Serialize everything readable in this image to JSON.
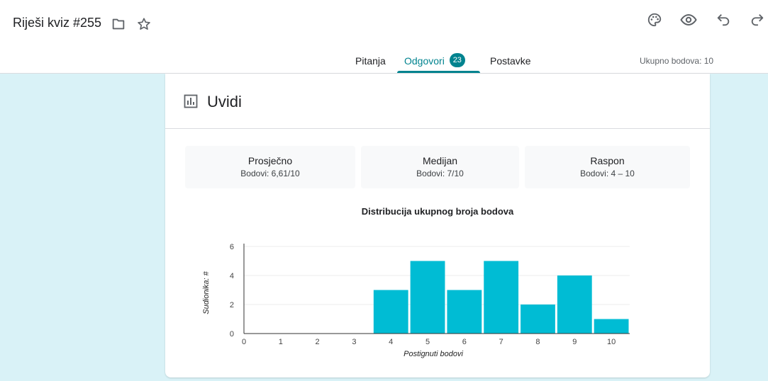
{
  "header": {
    "title": "Riješi kviz #255",
    "tabs": [
      {
        "label": "Pitanja"
      },
      {
        "label": "Odgovori",
        "badge": "23"
      },
      {
        "label": "Postavke"
      }
    ],
    "total_points": "Ukupno bodova: 10"
  },
  "icons": {
    "folder": "folder-icon",
    "star": "star-icon",
    "palette": "palette-icon",
    "preview": "eye-icon",
    "undo": "undo-icon",
    "redo": "redo-icon",
    "insights": "bar-chart-icon"
  },
  "insights": {
    "title": "Uvidi",
    "stats": [
      {
        "label": "Prosječno",
        "value": "Bodovi: 6,61/10"
      },
      {
        "label": "Medijan",
        "value": "Bodovi: 7/10"
      },
      {
        "label": "Raspon",
        "value": "Bodovi: 4 – 10"
      }
    ]
  },
  "colors": {
    "accent": "#00838f",
    "bar": "#00bcd4",
    "background": "#d9f2f7"
  },
  "chart_data": {
    "type": "bar",
    "title": "Distribucija ukupnog broja bodova",
    "xlabel": "Postignuti bodovi",
    "ylabel": "Sudionika: #",
    "categories": [
      "0",
      "1",
      "2",
      "3",
      "4",
      "5",
      "6",
      "7",
      "8",
      "9",
      "10"
    ],
    "values": [
      0,
      0,
      0,
      0,
      3,
      5,
      3,
      5,
      2,
      4,
      1
    ],
    "yticks": [
      "0",
      "2",
      "4",
      "6"
    ],
    "ylim": [
      0,
      6
    ],
    "grid": true
  }
}
